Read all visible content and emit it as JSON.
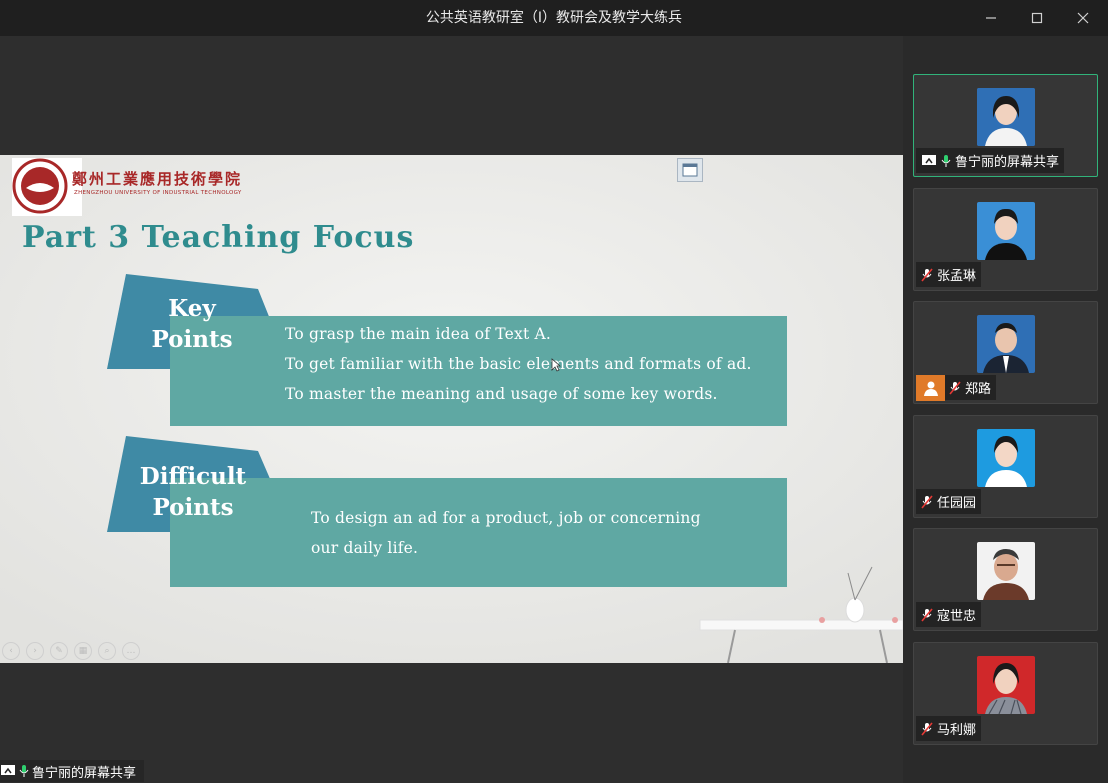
{
  "window": {
    "title": "公共英语教研室（I）教研会及教学大练兵"
  },
  "slide": {
    "school_name": "鄭州工業應用技術學院",
    "school_name_en": "ZHENGZHOU UNIVERSITY OF INDUSTRIAL TECHNOLOGY",
    "title": "Part  3  Teaching  Focus",
    "key_points": {
      "label_line1": "Key",
      "label_line2": "Points",
      "items": [
        "To grasp the main idea of Text A.",
        "To get familiar with the basic elements and formats of ad.",
        "To master the meaning and usage of some key words."
      ]
    },
    "difficult_points": {
      "label_line1": "Difficult",
      "label_line2": "Points",
      "items": [
        "To design an ad for a product,  job or concerning",
        "our daily life."
      ]
    }
  },
  "share_label": "鲁宁丽的屏幕共享",
  "participants": [
    {
      "name": "鲁宁丽的屏幕共享",
      "mic": "on",
      "sharing": true,
      "avatar_bg": "#2f6fb5",
      "active": true
    },
    {
      "name": "张孟琳",
      "mic": "muted",
      "avatar_bg": "#3a8fd6"
    },
    {
      "name": "郑路",
      "mic": "muted",
      "avatar_bg": "#2f6fb5",
      "host_icon": true
    },
    {
      "name": "任园园",
      "mic": "muted",
      "avatar_bg": "#1e9be0"
    },
    {
      "name": "寇世忠",
      "mic": "muted",
      "avatar_bg": "#f2f2f2"
    },
    {
      "name": "马利娜",
      "mic": "muted",
      "avatar_bg": "#d0282a"
    }
  ],
  "colors": {
    "teal_panel": "#5fa8a3",
    "ribbon_blue": "#3f8aa5",
    "title_teal": "#2f8c8e",
    "active_border": "#31b37a",
    "school_red": "#a82828"
  }
}
